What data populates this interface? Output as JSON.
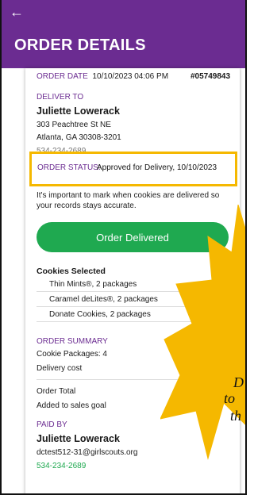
{
  "header": {
    "back_icon": "arrow-left-icon",
    "title": "ORDER DETAILS",
    "color": "#6b2c91"
  },
  "order": {
    "date_label": "ORDER DATE",
    "date_value": "10/10/2023 04:06 PM",
    "number": "#05749843"
  },
  "deliver_to": {
    "label": "DELIVER TO",
    "name": "Juliette Lowerack",
    "address_line1": "303 Peachtree St NE",
    "address_line2": "Atlanta, GA 30308-3201",
    "phone_partial": "534-234-2689"
  },
  "status": {
    "label": "ORDER STATUS:",
    "value": "Approved for Delivery, 10/10/2023",
    "highlight_color": "#f5b800"
  },
  "note": "It's important to mark when cookies are delivered so your records stays accurate.",
  "primary_button": {
    "label": "Order Delivered",
    "color": "#1fa950"
  },
  "cookies": {
    "title": "Cookies Selected",
    "items": [
      "Thin Mints®, 2 packages",
      "Caramel deLites®, 2 packages",
      "Donate Cookies, 2 packages"
    ]
  },
  "summary": {
    "title": "ORDER SUMMARY",
    "packages": "Cookie Packages: 4",
    "delivery_cost": "Delivery cost",
    "order_total": "Order Total",
    "added_to_goal": "Added to sales goal"
  },
  "paid_by": {
    "label": "PAID BY",
    "name": "Juliette Lowerack",
    "email": "dctest512-31@girlscouts.org",
    "phone": "534-234-2689"
  },
  "callout": {
    "line1": "D",
    "line2": "to",
    "line3": "th",
    "color": "#f5b800"
  }
}
